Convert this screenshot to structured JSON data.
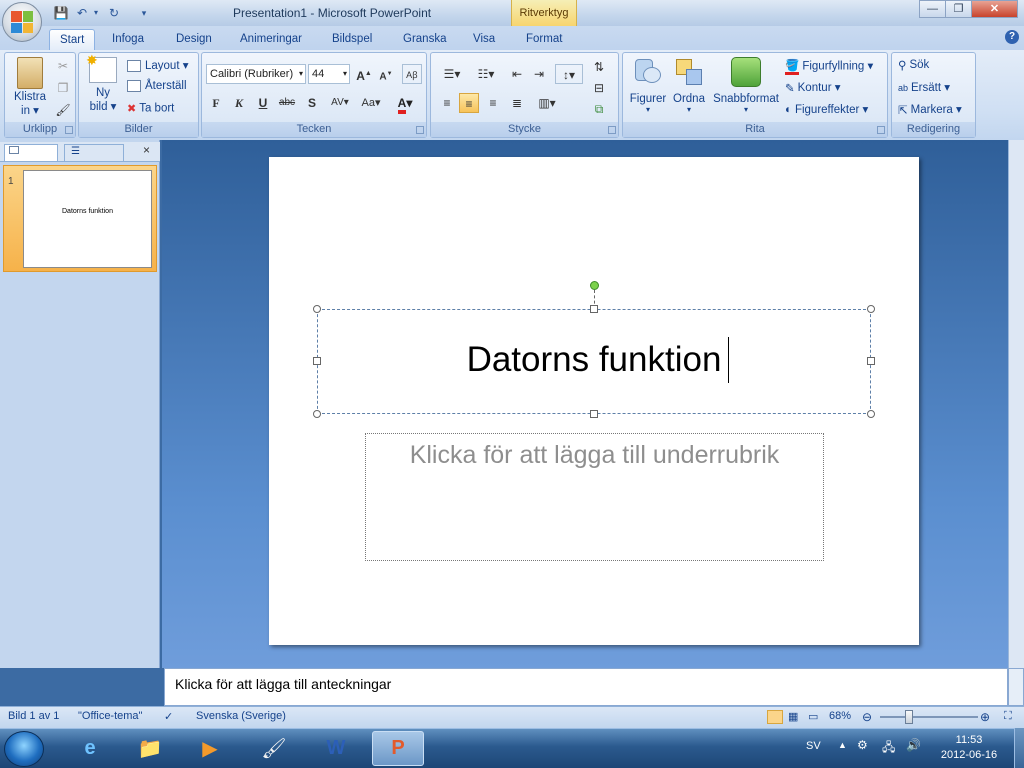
{
  "window": {
    "title": "Presentation1 - Microsoft PowerPoint",
    "contextual_tab_group": "Ritverktyg"
  },
  "tabs": [
    "Start",
    "Infoga",
    "Design",
    "Animeringar",
    "Bildspel",
    "Granska",
    "Visa",
    "Format"
  ],
  "ribbon": {
    "clipboard": {
      "label": "Urklipp",
      "paste_line1": "Klistra",
      "paste_line2": "in"
    },
    "slides": {
      "label": "Bilder",
      "new_line1": "Ny",
      "new_line2": "bild",
      "layout": "Layout",
      "reset": "Återställ",
      "delete": "Ta bort"
    },
    "font": {
      "label": "Tecken",
      "font_name": "Calibri (Rubriker)",
      "font_size": "44",
      "bold": "F",
      "italic": "K",
      "underline": "U",
      "strike": "abc",
      "shadow": "S",
      "spacing": "AV",
      "case": "Aa",
      "color": "A"
    },
    "paragraph": {
      "label": "Stycke"
    },
    "drawing": {
      "label": "Rita",
      "shapes": "Figurer",
      "arrange": "Ordna",
      "quick_styles": "Snabbformat",
      "fill": "Figurfyllning",
      "outline": "Kontur",
      "effects": "Figureffekter"
    },
    "editing": {
      "label": "Redigering",
      "find": "Sök",
      "replace": "Ersätt",
      "select": "Markera"
    }
  },
  "slide": {
    "number": "1",
    "title": "Datorns funktion",
    "subtitle_placeholder": "Klicka för att lägga till underrubrik"
  },
  "notes_placeholder": "Klicka för att lägga till anteckningar",
  "status": {
    "slide_info": "Bild 1 av 1",
    "theme": "\"Office-tema\"",
    "language": "Svenska (Sverige)",
    "zoom": "68%",
    "zoom_level": 0.68
  },
  "taskbar": {
    "lang": "SV",
    "time": "11:53",
    "date": "2012-06-16"
  },
  "colors": {
    "ribbon_text": "#15428b",
    "accent_selection": "#f6b24a",
    "slide_bg": "#3c6ba3"
  }
}
